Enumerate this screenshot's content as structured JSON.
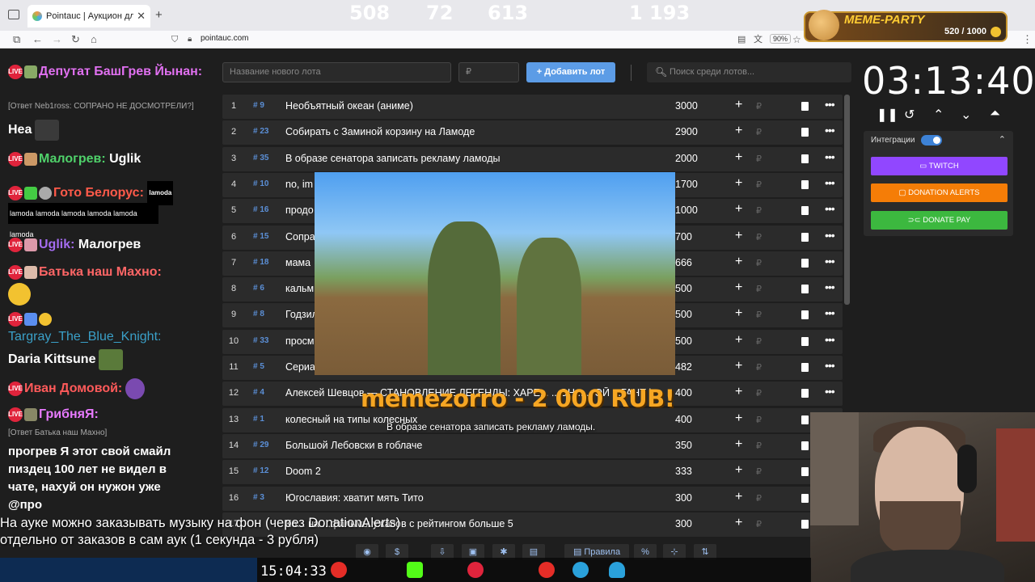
{
  "browser": {
    "tab_title": "Pointauc | Аукцион для стриме",
    "url": "pointauc.com",
    "zoom": "90%"
  },
  "meme_party": {
    "title": "MEME-PARTY",
    "count": "520 / 1000"
  },
  "chat": {
    "m1_name": "Депутат БашГрев Йынан:",
    "m1_reply": "[Ответ Neb1ross: СОПРАНО НЕ ДОСМОТРЕЛИ?]",
    "m1_body": "Неа",
    "m2_name": "Малогрев:",
    "m2_body": "Uglik",
    "m3_name": "Гото Белорус:",
    "m3_emote": "lamoda",
    "m3_strip": "lamoda lamoda lamoda lamoda lamoda lamoda",
    "m4_name": "Uglik:",
    "m4_body": "Малогрев",
    "m5_name": "Батька наш Махно:",
    "m6_name": "Targray_The_Blue_Knight:",
    "m6_body": "Daria Kittsune",
    "m7_name": "Иван Домовой:",
    "m8_name": "Гриб⁠няЯ:",
    "m8_reply": "[Ответ Батька наш Махно]",
    "m8_user": "прогрев",
    "m8_l1": "Я этот свой смайл",
    "m8_l2": "пиздец 100 лет не видел в",
    "m8_l3": "чате, нахуй он нужон уже",
    "m8_l4": "@про"
  },
  "auction": {
    "new_lot_placeholder": "Название нового лота",
    "amount_placeholder": "₽",
    "add_button": "Добавить лот",
    "search_placeholder": "Поиск среди лотов...",
    "lots": [
      {
        "n": "1",
        "id": "# 9",
        "name": "Необъятный океан (аниме)",
        "amount": "3000"
      },
      {
        "n": "2",
        "id": "# 23",
        "name": "Собирать с Заминой корзину на Ламоде",
        "amount": "2900"
      },
      {
        "n": "3",
        "id": "# 35",
        "name": "В образе сенатора записать рекламу ламоды",
        "amount": "2000"
      },
      {
        "n": "4",
        "id": "# 10",
        "name": "no, im",
        "amount": "1700"
      },
      {
        "n": "5",
        "id": "# 16",
        "name": "продо",
        "amount": "1000"
      },
      {
        "n": "6",
        "id": "# 15",
        "name": "Сопра",
        "amount": "700"
      },
      {
        "n": "7",
        "id": "# 18",
        "name": "мама",
        "amount": "666"
      },
      {
        "n": "8",
        "id": "# 6",
        "name": "кальм",
        "amount": "500"
      },
      {
        "n": "9",
        "id": "# 8",
        "name": "Годзил",
        "amount": "500"
      },
      {
        "n": "10",
        "id": "# 33",
        "name": "просм",
        "amount": "500"
      },
      {
        "n": "11",
        "id": "# 5",
        "name": "Сериа",
        "amount": "482"
      },
      {
        "n": "12",
        "id": "# 4",
        "name": "Алексей Шевцов — СТАНОВЛЕНИЕ ЛЕГЕНДЫ: ХАРЕ... ...ОН... ...ОЙ ...ГАНТ |",
        "amount": "400"
      },
      {
        "n": "13",
        "id": "# 1",
        "name": "колесный на типы колесных",
        "amount": "400"
      },
      {
        "n": "14",
        "id": "# 29",
        "name": "Большой Лебовски в гоблаче",
        "amount": "350"
      },
      {
        "n": "15",
        "id": "# 12",
        "name": "Doom 2",
        "amount": "333"
      },
      {
        "n": "16",
        "id": "# 3",
        "name": "Югославия: хватит мять Тито",
        "amount": "300"
      },
      {
        "n": "17",
        "id": "",
        "name": "Ко... на ...фильмы ужасов с рейтингом больше 5",
        "amount": "300"
      }
    ]
  },
  "donation_alert": {
    "title": "memezorro - 2 000 RUB!",
    "message": "В образе сенатора записать рекламу ламоды."
  },
  "timer": "03:13:40",
  "integrations": {
    "label": "Интеграции",
    "twitch": "TWITCH",
    "donation_alerts": "DONATION ALERTS",
    "donate_pay": "DONATE PAY",
    "colors": {
      "twitch": "#9147ff",
      "donation_alerts": "#f57d07",
      "donate_pay": "#3cb83f"
    }
  },
  "ticker": {
    "line1": "На ауке можно заказывать музыку на фон (через DonationAlerts)",
    "line2": "отдельно от заказов в сам аук (1 секунда - 3 рубля)"
  },
  "toolbar": {
    "rules": "Правила",
    "percent": "%"
  },
  "stream_stats": {
    "clock": "15:04:33",
    "youtube": "508",
    "kick": "72",
    "vk_live": "613",
    "telegram_viewers": "1 193"
  }
}
